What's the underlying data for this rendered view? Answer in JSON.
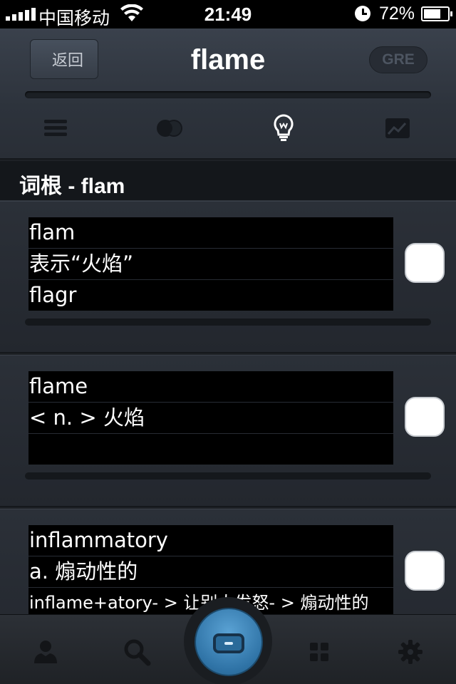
{
  "status_bar": {
    "carrier": "中国移动",
    "time": "21:49",
    "battery_percent": "72%",
    "battery_level": 0.72
  },
  "nav": {
    "back_label": "返回",
    "title": "flame",
    "badge": "GRE",
    "progress": 0.0,
    "tabs": [
      {
        "icon": "list-icon"
      },
      {
        "icon": "circles-icon"
      },
      {
        "icon": "lightbulb-icon",
        "active": true
      },
      {
        "icon": "chart-icon"
      }
    ]
  },
  "section": {
    "title_zh": "词根",
    "title_rest": " - flam"
  },
  "cards": [
    {
      "lines": [
        "flam",
        "表示“火焰”",
        "flagr"
      ]
    },
    {
      "lines": [
        "flame",
        "< n. > 火焰",
        ""
      ]
    },
    {
      "lines": [
        "inflammatory",
        "a.  煽动性的",
        "inflame+atory- > 让别人发怒- > 煽动性的"
      ]
    }
  ],
  "tab_bar": {
    "items": [
      "person-icon",
      "search-icon",
      "center-card-icon",
      "grid-icon",
      "gear-icon"
    ]
  },
  "colors": {
    "accent": "#3f8cc4",
    "nav_bg": "#2f353e",
    "card_bg": "#272b32"
  }
}
